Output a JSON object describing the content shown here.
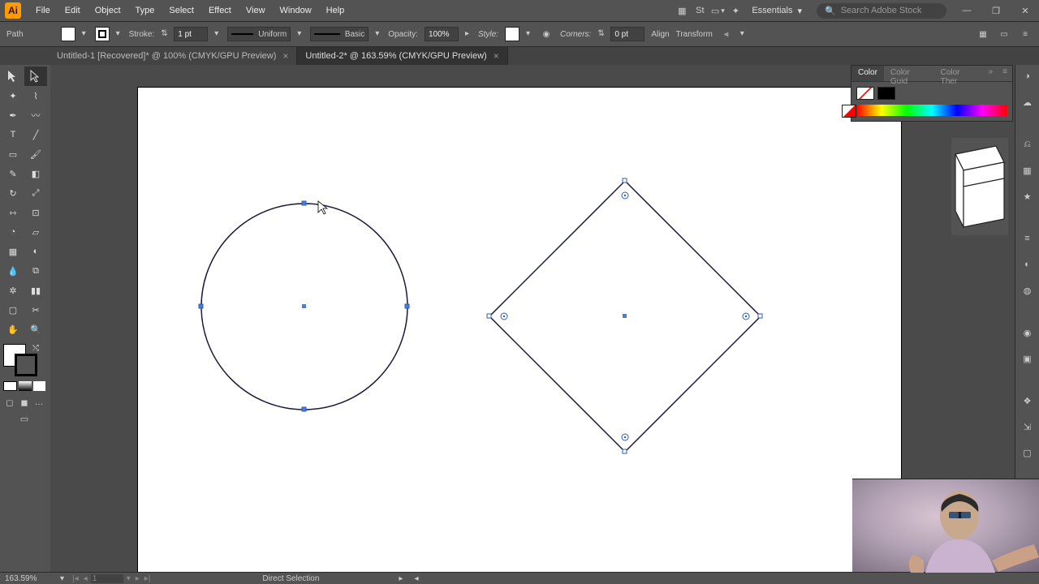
{
  "menu": {
    "items": [
      "File",
      "Edit",
      "Object",
      "Type",
      "Select",
      "Effect",
      "View",
      "Window",
      "Help"
    ]
  },
  "workspace": {
    "label": "Essentials"
  },
  "search": {
    "placeholder": "Search Adobe Stock"
  },
  "control": {
    "selection": "Path",
    "stroke_label": "Stroke:",
    "stroke_value": "1 pt",
    "profile": "Uniform",
    "brush": "Basic",
    "opacity_label": "Opacity:",
    "opacity_value": "100%",
    "style_label": "Style:",
    "corners_label": "Corners:",
    "corners_value": "0 pt",
    "align_label": "Align",
    "transform_label": "Transform"
  },
  "tabs": [
    {
      "label": "Untitled-1 [Recovered]* @ 100% (CMYK/GPU Preview)",
      "active": false
    },
    {
      "label": "Untitled-2* @ 163.59% (CMYK/GPU Preview)",
      "active": true
    }
  ],
  "colorPanel": {
    "tabs": [
      "Color",
      "Color Guid",
      "Color Ther"
    ]
  },
  "status": {
    "zoom": "163.59%",
    "artboard_num": "1",
    "tool": "Direct Selection"
  }
}
